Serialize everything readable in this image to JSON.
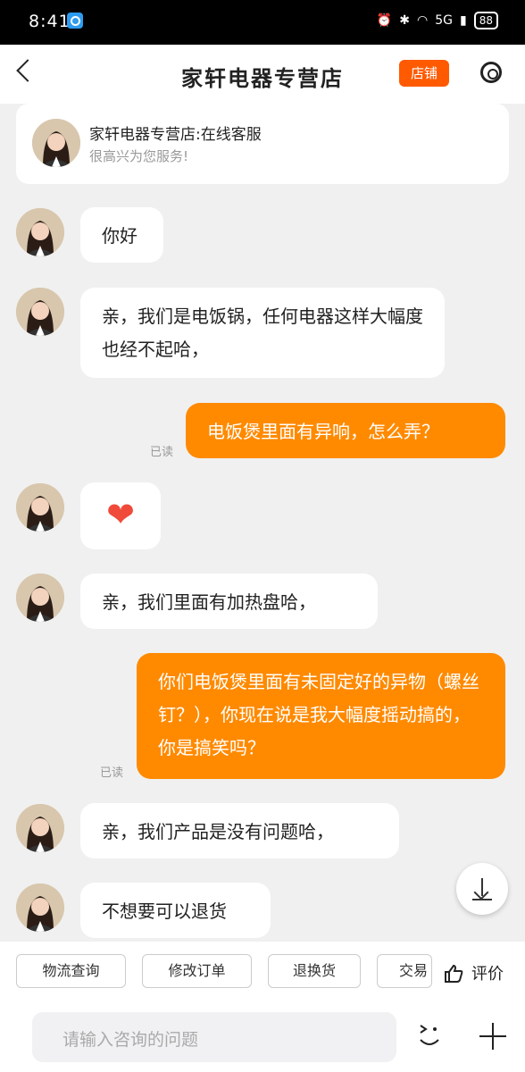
{
  "status": {
    "time": "8:41",
    "network": "5G",
    "battery": "88"
  },
  "header": {
    "title": "家轩电器专营店",
    "shop_button": "店铺"
  },
  "service_card": {
    "name": "家轩电器专营店:在线客服",
    "subtitle": "很高兴为您服务!"
  },
  "messages": [
    {
      "from": "agent",
      "text": "你好"
    },
    {
      "from": "agent",
      "text": "亲，我们是电饭锅，任何电器这样大幅度也经不起哈，"
    },
    {
      "from": "user",
      "text": "电饭煲里面有异响，怎么弄？",
      "status": "已读"
    },
    {
      "from": "agent",
      "text": "❤"
    },
    {
      "from": "agent",
      "text": "亲，我们里面有加热盘哈，"
    },
    {
      "from": "user",
      "text": "你们电饭煲里面有未固定好的异物（螺丝钉？），你现在说是我大幅度摇动搞的，你是搞笑吗？",
      "status": "已读"
    },
    {
      "from": "agent",
      "text": "亲，我们产品是没有问题哈，"
    },
    {
      "from": "agent",
      "text": "不想要可以退货"
    }
  ],
  "quick_actions": [
    "物流查询",
    "修改订单",
    "退换货",
    "交易"
  ],
  "review_label": "评价",
  "input": {
    "placeholder": "请输入咨询的问题"
  },
  "colors": {
    "accent": "#ff8a00",
    "shop_button": "#ff5a00",
    "background": "#f0f0f0"
  }
}
